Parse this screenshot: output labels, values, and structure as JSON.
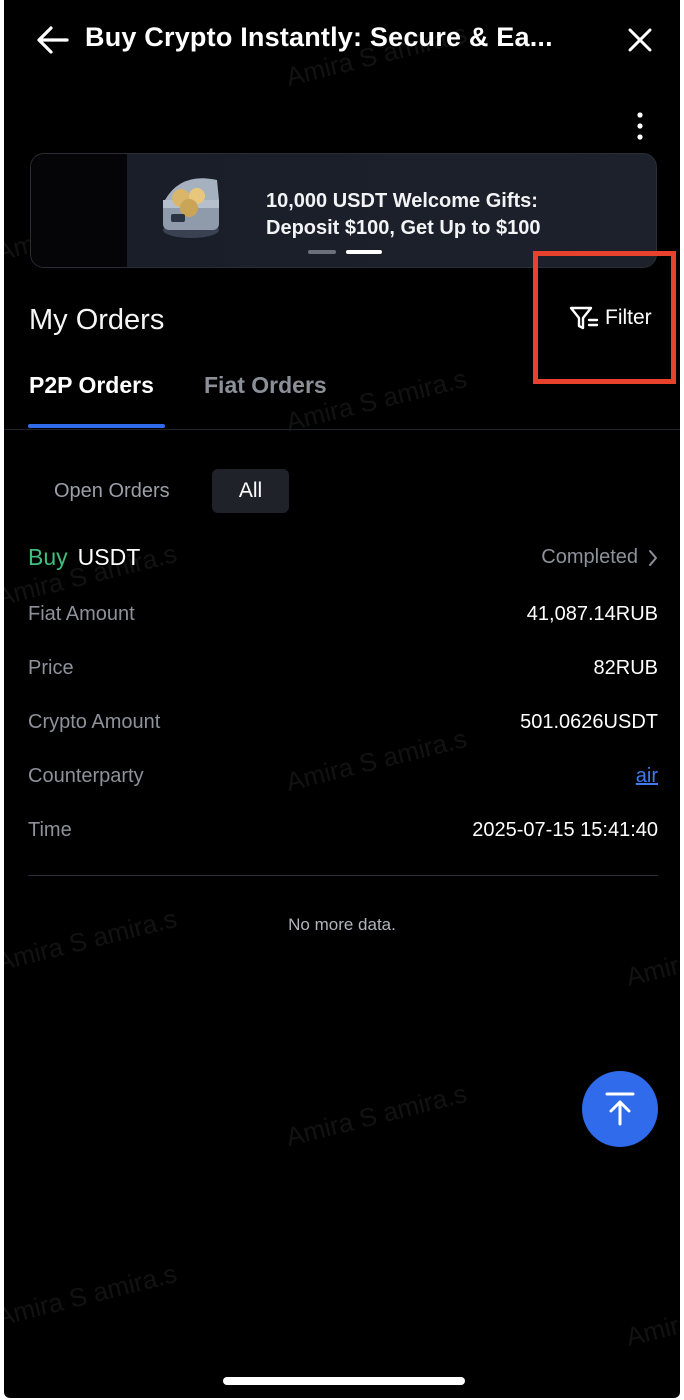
{
  "header": {
    "title": "Buy Crypto Instantly: Secure & Ea..."
  },
  "banner": {
    "line1": "10,000 USDT Welcome Gifts:",
    "line2": "Deposit $100, Get Up to $100",
    "slide_count": 2,
    "active_slide": 2
  },
  "orders_section": {
    "title": "My Orders",
    "filter_label": "Filter"
  },
  "tabs": [
    {
      "label": "P2P Orders",
      "active": true
    },
    {
      "label": "Fiat Orders",
      "active": false
    }
  ],
  "segment": {
    "open_label": "Open Orders",
    "all_label": "All",
    "selected": "All"
  },
  "order": {
    "side": "Buy",
    "coin": "USDT",
    "status": "Completed",
    "rows": [
      {
        "label": "Fiat Amount",
        "value": "41,087.14RUB"
      },
      {
        "label": "Price",
        "value": "82RUB"
      },
      {
        "label": "Crypto Amount",
        "value": "501.0626USDT"
      },
      {
        "label": "Counterparty",
        "value": "air"
      },
      {
        "label": "Time",
        "value": "2025-07-15 15:41:40"
      }
    ]
  },
  "footer": {
    "no_more": "No more data."
  },
  "watermark": "Amira S amira.s",
  "colors": {
    "accent": "#2f6bea",
    "buy": "#3fbf7d",
    "highlight": "#e8412c",
    "background": "#000000"
  }
}
